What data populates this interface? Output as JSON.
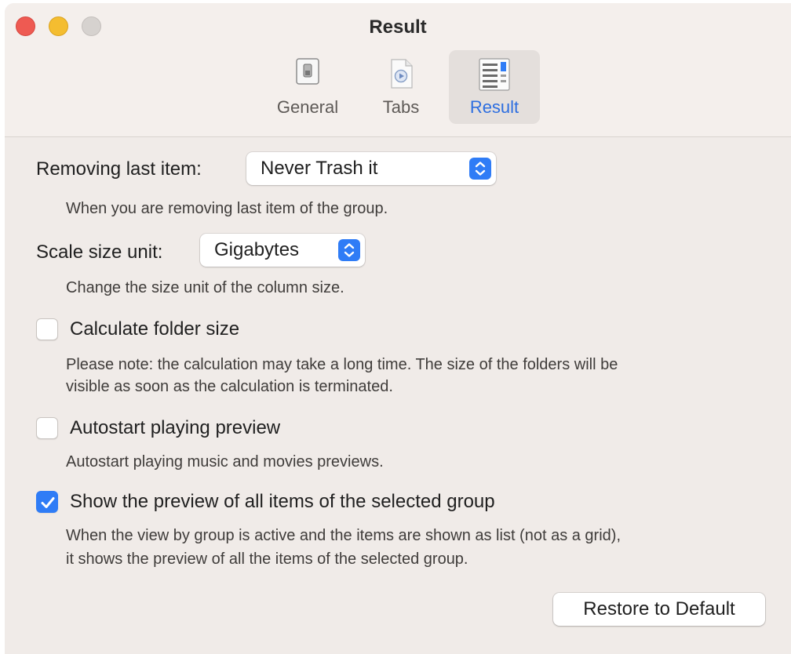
{
  "window": {
    "title": "Result"
  },
  "toolbar": {
    "tabs": [
      {
        "label": "General",
        "icon": "switch-icon",
        "selected": false
      },
      {
        "label": "Tabs",
        "icon": "document-play-icon",
        "selected": false
      },
      {
        "label": "Result",
        "icon": "list-view-icon",
        "selected": true
      }
    ]
  },
  "settings": {
    "removing_last_item": {
      "label": "Removing last item:",
      "value": "Never Trash it",
      "help": "When you are removing last item of the group."
    },
    "scale_size_unit": {
      "label": "Scale size unit:",
      "value": "Gigabytes",
      "help": "Change the size unit of the column size."
    },
    "calculate_folder_size": {
      "label": "Calculate folder size",
      "checked": false,
      "help_line1": "Please note: the calculation may take a long time. The size of the folders will be",
      "help_line2": "visible as soon as the calculation is terminated."
    },
    "autostart_preview": {
      "label": "Autostart playing preview",
      "checked": false,
      "help": "Autostart playing music and movies previews."
    },
    "show_preview_all": {
      "label": "Show the preview of all items of the selected group",
      "checked": true,
      "help_line1": "When the view by group is active and the items are shown as list (not as a grid),",
      "help_line2": "it shows the preview of all the items of the selected group."
    }
  },
  "footer": {
    "restore_label": "Restore to Default"
  },
  "colors": {
    "accent": "#2f7cf6",
    "window_bg": "#f0ebe8",
    "close": "#ee5a52",
    "minimize": "#f4bd30",
    "zoom": "#d6d2cf"
  }
}
